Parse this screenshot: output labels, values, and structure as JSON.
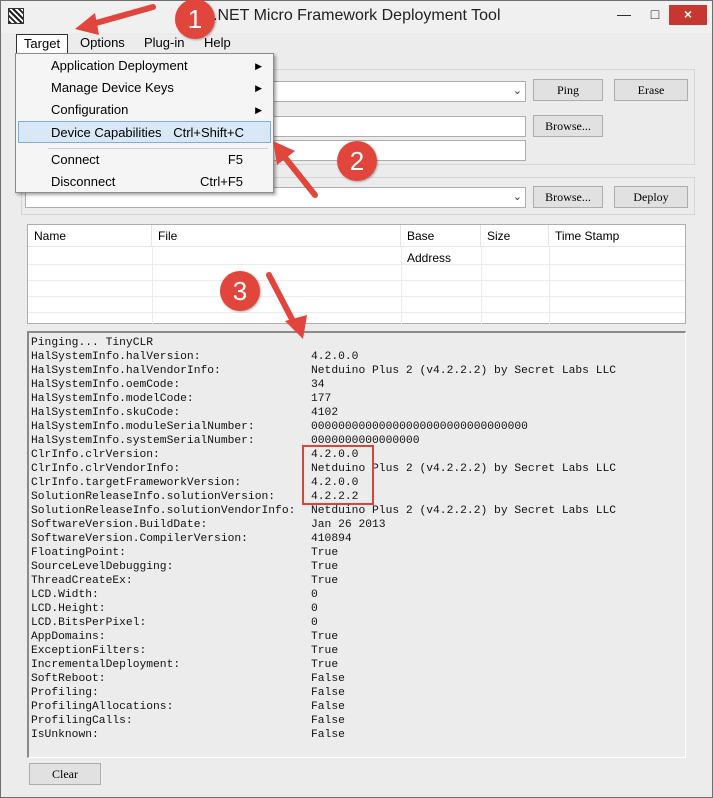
{
  "window": {
    "title": ".NET Micro Framework Deployment Tool",
    "close_symbol": "×",
    "minimize_symbol": "—",
    "maximize_symbol": "□"
  },
  "menubar": {
    "items": [
      "Target",
      "Options",
      "Plug-in",
      "Help"
    ]
  },
  "target_menu": {
    "items": [
      {
        "label": "Application Deployment",
        "shortcut": "",
        "submenu": true
      },
      {
        "label": "Manage Device Keys",
        "shortcut": "",
        "submenu": true
      },
      {
        "label": "Configuration",
        "shortcut": "",
        "submenu": true
      },
      {
        "label": "Device Capabilities",
        "shortcut": "Ctrl+Shift+C",
        "submenu": false,
        "selected": true
      },
      {
        "label": "Connect",
        "shortcut": "F5",
        "submenu": false
      },
      {
        "label": "Disconnect",
        "shortcut": "Ctrl+F5",
        "submenu": false
      }
    ]
  },
  "device_group": {
    "ping_label": "Ping",
    "erase_label": "Erase",
    "browse_label": "Browse..."
  },
  "deploy_group": {
    "browse_label": "Browse...",
    "deploy_label": "Deploy"
  },
  "file_list": {
    "columns": [
      "Name",
      "File",
      "Base Address",
      "Size",
      "Time Stamp"
    ]
  },
  "output": {
    "first_line": "Pinging... TinyCLR",
    "lines": [
      {
        "key": "HalSystemInfo.halVersion:",
        "value": "4.2.0.0"
      },
      {
        "key": "HalSystemInfo.halVendorInfo:",
        "value": "Netduino Plus 2 (v4.2.2.2) by Secret Labs LLC"
      },
      {
        "key": "HalSystemInfo.oemCode:",
        "value": "34"
      },
      {
        "key": "HalSystemInfo.modelCode:",
        "value": "177"
      },
      {
        "key": "HalSystemInfo.skuCode:",
        "value": "4102"
      },
      {
        "key": "HalSystemInfo.moduleSerialNumber:",
        "value": "00000000000000000000000000000000"
      },
      {
        "key": "HalSystemInfo.systemSerialNumber:",
        "value": "0000000000000000"
      },
      {
        "key": "ClrInfo.clrVersion:",
        "value": "4.2.0.0"
      },
      {
        "key": "ClrInfo.clrVendorInfo:",
        "value": "Netduino Plus 2 (v4.2.2.2) by Secret Labs LLC"
      },
      {
        "key": "ClrInfo.targetFrameworkVersion:",
        "value": "4.2.0.0"
      },
      {
        "key": "SolutionReleaseInfo.solutionVersion:",
        "value": "4.2.2.2"
      },
      {
        "key": "SolutionReleaseInfo.solutionVendorInfo:",
        "value": "Netduino Plus 2 (v4.2.2.2) by Secret Labs LLC"
      },
      {
        "key": "SoftwareVersion.BuildDate:",
        "value": "Jan 26 2013"
      },
      {
        "key": "SoftwareVersion.CompilerVersion:",
        "value": "410894"
      },
      {
        "key": "FloatingPoint:",
        "value": "True"
      },
      {
        "key": "SourceLevelDebugging:",
        "value": "True"
      },
      {
        "key": "ThreadCreateEx:",
        "value": "True"
      },
      {
        "key": "LCD.Width:",
        "value": "0"
      },
      {
        "key": "LCD.Height:",
        "value": "0"
      },
      {
        "key": "LCD.BitsPerPixel:",
        "value": "0"
      },
      {
        "key": "AppDomains:",
        "value": "True"
      },
      {
        "key": "ExceptionFilters:",
        "value": "True"
      },
      {
        "key": "IncrementalDeployment:",
        "value": "True"
      },
      {
        "key": "SoftReboot:",
        "value": "False"
      },
      {
        "key": "Profiling:",
        "value": "False"
      },
      {
        "key": "ProfilingAllocations:",
        "value": "False"
      },
      {
        "key": "ProfilingCalls:",
        "value": "False"
      },
      {
        "key": "IsUnknown:",
        "value": "False"
      }
    ]
  },
  "clear_label": "Clear",
  "annotations": {
    "badge1": "1",
    "badge2": "2",
    "badge3": "3",
    "color": "#e1453b"
  }
}
